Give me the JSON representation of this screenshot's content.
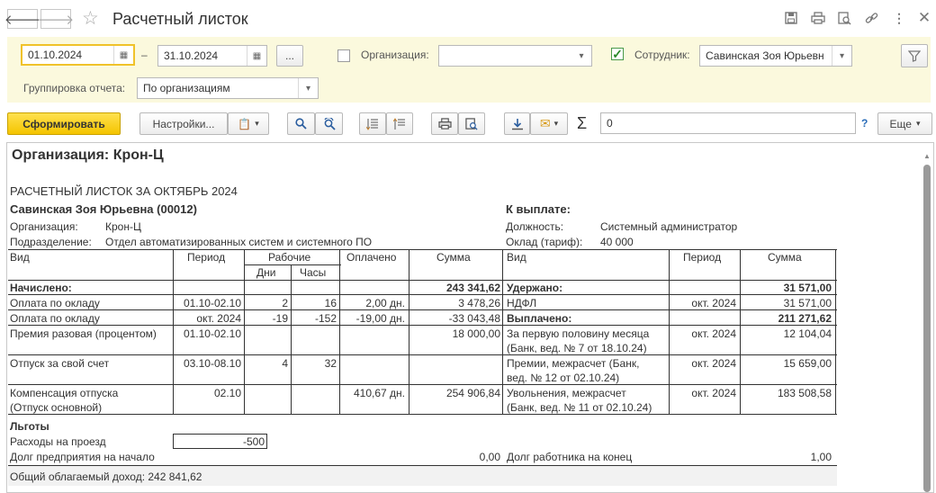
{
  "window": {
    "title": "Расчетный листок",
    "back_icon": "arrow-left-icon",
    "forward_icon": "arrow-right-icon",
    "favorite_icon": "star-icon",
    "toolbar_icons": [
      "save-icon",
      "print-icon",
      "preview-icon",
      "link-icon",
      "more-icon",
      "close-icon"
    ]
  },
  "filters": {
    "date_from": "01.10.2024",
    "date_dash": "–",
    "date_to": "31.10.2024",
    "ellipsis_label": "...",
    "org_label": "Организация:",
    "org_value": "",
    "employee_label": "Сотрудник:",
    "employee_value": "Савинская Зоя Юрьевн",
    "employee_checked": true,
    "grouping_label": "Группировка отчета:",
    "grouping_value": "По организациям"
  },
  "actions": {
    "generate_label": "Сформировать",
    "settings_label": "Настройки...",
    "sum_symbol": "Σ",
    "sum_value": "0",
    "help_label": "?",
    "more_label": "Еще"
  },
  "report": {
    "org_heading": "Организация: Крон-Ц",
    "title": "РАСЧЕТНЫЙ ЛИСТОК ЗА ОКТЯБРЬ 2024",
    "employee": "Савинская Зоя Юрьевна (00012)",
    "payout_heading": "К выплате:",
    "org_label": "Организация:",
    "org_value": "Крон-Ц",
    "dept_label": "Подразделение:",
    "dept_value": "Отдел автоматизированных систем и системного ПО",
    "position_label": "Должность:",
    "position_value": "Системный администратор",
    "salary_label": "Оклад (тариф):",
    "salary_value": "40 000",
    "headers": {
      "kind": "Вид",
      "period": "Период",
      "worked": "Рабочие",
      "days": "Дни",
      "hours": "Часы",
      "paid": "Оплачено",
      "sum": "Сумма",
      "kind2": "Вид",
      "period2": "Период",
      "sum2": "Сумма"
    },
    "accrued_label": "Начислено:",
    "accrued_total": "243 341,62",
    "withheld_label": "Удержано:",
    "withheld_total": "31 571,00",
    "paid_label": "Выплачено:",
    "paid_total": "211 271,62",
    "left_rows": [
      {
        "kind": "Оплата по окладу",
        "period": "01.10-02.10",
        "days": "2",
        "hours": "16",
        "paid": "2,00 дн.",
        "sum": "3 478,26"
      },
      {
        "kind": "Оплата по окладу",
        "period": "окт. 2024",
        "days": "-19",
        "hours": "-152",
        "paid": "-19,00 дн.",
        "sum": "-33 043,48"
      },
      {
        "kind": "Премия разовая (процентом)",
        "period": "01.10-02.10",
        "days": "",
        "hours": "",
        "paid": "",
        "sum": "18 000,00"
      },
      {
        "kind": "Отпуск за свой счет",
        "period": "03.10-08.10",
        "days": "4",
        "hours": "32",
        "paid": "",
        "sum": ""
      },
      {
        "kind": "Компенсация отпуска",
        "kind_2": "(Отпуск основной)",
        "period": "02.10",
        "days": "",
        "hours": "",
        "paid": "410,67 дн.",
        "sum": "254 906,84"
      }
    ],
    "ndfl": {
      "kind": "НДФЛ",
      "period": "окт. 2024",
      "sum": "31 571,00"
    },
    "right_rows": [
      {
        "kind": "За первую половину месяца",
        "kind_2": "(Банк, вед. № 7 от 18.10.24)",
        "period": "окт. 2024",
        "sum": "12 104,04"
      },
      {
        "kind": "Премии, межрасчет (Банк,",
        "kind_2": "вед. № 12 от 02.10.24)",
        "period": "окт. 2024",
        "sum": "15 659,00"
      },
      {
        "kind": "Увольнения, межрасчет",
        "kind_2": "(Банк, вед. № 11 от 02.10.24)",
        "period": "окт. 2024",
        "sum": "183 508,58"
      }
    ],
    "benefits_label": "Льготы",
    "travel_label": "Расходы на проезд",
    "travel_value": "-500",
    "debt_start_label": "Долг предприятия на начало",
    "debt_start_value": "0,00",
    "debt_end_label": "Долг работника на конец",
    "debt_end_value": "1,00",
    "taxable_label": "Общий облагаемый доход: 242 841,62"
  }
}
